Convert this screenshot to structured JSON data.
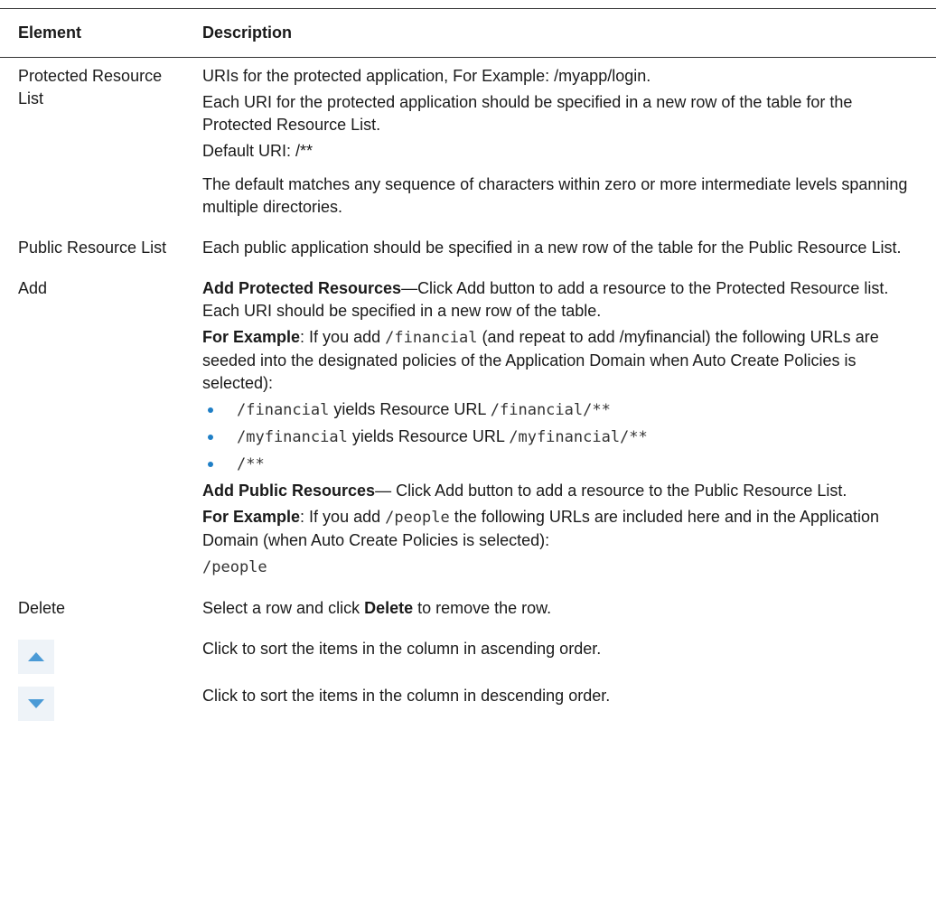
{
  "table": {
    "headers": {
      "element": "Element",
      "description": "Description"
    },
    "rows": {
      "protected": {
        "element": "Protected Resource List",
        "p1": "URIs for the protected application, For Example: /myapp/login.",
        "p2": "Each URI for the protected application should be specified in a new row of the table for the Protected Resource List.",
        "p3": "Default URI: /**",
        "p4": "The default matches any sequence of characters within zero or more intermediate levels spanning multiple directories."
      },
      "public": {
        "element": "Public Resource List",
        "p1": "Each public application should be specified in a new row of the table for the Public Resource List."
      },
      "add": {
        "element": "Add",
        "prot_title": "Add Protected Resources",
        "prot_text": "—Click Add button to add a resource to the Protected Resource list. Each URI should be specified in a new row of the table.",
        "ex1_label": "For Example",
        "ex1_a": ": If you add ",
        "ex1_code": "/financial",
        "ex1_b": "  (and repeat to add /myfinancial) the following URLs are seeded into the designated policies of the Application Domain when Auto Create Policies is selected):",
        "bullets": [
          {
            "code1": "/financial",
            "text": " yields Resource URL ",
            "code2": "/financial/**"
          },
          {
            "code1": "/myfinancial",
            "text": " yields Resource URL ",
            "code2": "/myfinancial/**"
          },
          {
            "code1": "/**",
            "text": "",
            "code2": ""
          }
        ],
        "pub_title": "Add Public Resources",
        "pub_text": "— Click Add button to add a resource to the Public Resource List.",
        "ex2_label": "For Example",
        "ex2_a": ": If you add ",
        "ex2_code": "/people",
        "ex2_b": " the following URLs are included here and in the Application Domain (when Auto Create Policies is selected):",
        "ex2_result": "/people"
      },
      "delete": {
        "element": "Delete",
        "text_a": "Select a row and click ",
        "text_bold": "Delete",
        "text_b": " to remove the row."
      },
      "sort_asc": {
        "icon": "sort-ascending-icon",
        "text": "Click to sort the items in the column in ascending order."
      },
      "sort_desc": {
        "icon": "sort-descending-icon",
        "text": "Click to sort the items in the column in descending order."
      }
    }
  },
  "colors": {
    "bullet": "#1f7fc6",
    "sort_arrow": "#4a9ad6",
    "icon_bg": "#eef3f8"
  }
}
